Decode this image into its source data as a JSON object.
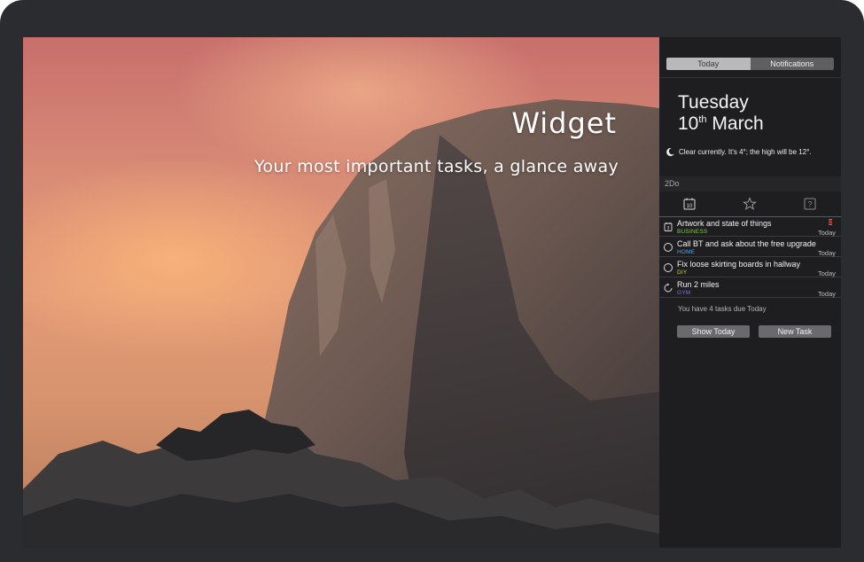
{
  "hero": {
    "title": "Widget",
    "subtitle": "Your most important tasks, a glance away"
  },
  "panel": {
    "tabs": [
      {
        "label": "Today",
        "active": true
      },
      {
        "label": "Notifications",
        "active": false
      }
    ],
    "date": {
      "weekday": "Tuesday",
      "day_number": "10",
      "day_suffix": "th",
      "month": "March"
    },
    "weather": {
      "icon": "moon-icon",
      "text": "Clear currently. It's 4°; the high will be 12°."
    },
    "widget": {
      "name": "2Do",
      "icons": [
        "calendar-icon",
        "star-icon",
        "help-icon"
      ],
      "calendar_day": "10",
      "tasks": [
        {
          "title": "Artwork and state of things",
          "tag": "BUSINESS",
          "tag_color": "#8bc34a",
          "due": "Today",
          "check": "calendar-checkbox-icon",
          "flagged": true
        },
        {
          "title": "Call BT and ask about the free upgrade",
          "tag": "HOME",
          "tag_color": "#3fa9f5",
          "due": "Today",
          "check": "circle-checkbox-icon",
          "flagged": false
        },
        {
          "title": "Fix loose skirting boards in hallway",
          "tag": "DIY",
          "tag_color": "#d4c84a",
          "due": "Today",
          "check": "circle-checkbox-icon",
          "flagged": false
        },
        {
          "title": "Run 2 miles",
          "tag": "GYM",
          "tag_color": "#8a6ee0",
          "due": "Today",
          "check": "repeat-checkbox-icon",
          "flagged": false
        }
      ],
      "summary": "You have 4 tasks due Today",
      "buttons": {
        "show_today": "Show Today",
        "new_task": "New Task"
      }
    }
  },
  "colors": {
    "bezel": "#2b2c2f",
    "panel_bg": "#1e1e20",
    "flag": "#e0533d"
  }
}
